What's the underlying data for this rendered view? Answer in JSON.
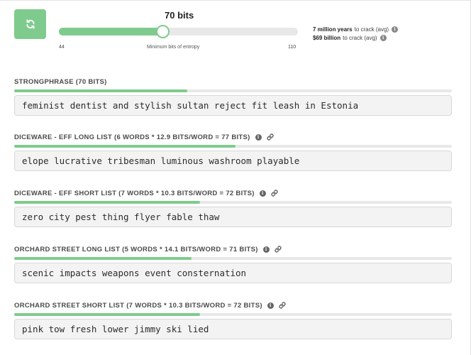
{
  "header": {
    "refresh_icon": "refresh-icon",
    "bits_title": "70 bits",
    "slider": {
      "min": "44",
      "max": "110",
      "caption": "Minimum bits of entropy",
      "value": 70,
      "min_value": 44,
      "max_value": 110
    },
    "crack_time": {
      "value": "7 million years",
      "suffix": "to crack (avg)"
    },
    "crack_cost": {
      "value": "$69 billion",
      "suffix": "to crack (avg)"
    }
  },
  "sections": [
    {
      "label": "STRONGPHRASE (70 BITS)",
      "password": "feminist dentist and stylish sultan reject fit leash in Estonia",
      "strength": 0.395,
      "has_info": false,
      "has_link": false
    },
    {
      "label": "DICEWARE - EFF LONG LIST (6 WORDS * 12.9 BITS/WORD = 77 BITS)",
      "password": "elope lucrative tribesman luminous washroom playable",
      "strength": 0.506,
      "has_info": true,
      "has_link": true
    },
    {
      "label": "DICEWARE - EFF SHORT LIST (7 WORDS * 10.3 BITS/WORD = 72 BITS)",
      "password": "zero city pest thing flyer fable thaw",
      "strength": 0.425,
      "has_info": true,
      "has_link": true
    },
    {
      "label": "ORCHARD STREET LONG LIST (5 WORDS * 14.1 BITS/WORD = 71 BITS)",
      "password": "scenic impacts weapons event consternation",
      "strength": 0.405,
      "has_info": true,
      "has_link": true
    },
    {
      "label": "ORCHARD STREET SHORT LIST (7 WORDS * 10.3 BITS/WORD = 72 BITS)",
      "password": "pink tow fresh lower jimmy ski lied",
      "strength": 0.425,
      "has_info": true,
      "has_link": true
    }
  ],
  "colors": {
    "accent": "#7fcb8d",
    "track": "#e8e8e8",
    "box_bg": "#f3f3f4"
  }
}
